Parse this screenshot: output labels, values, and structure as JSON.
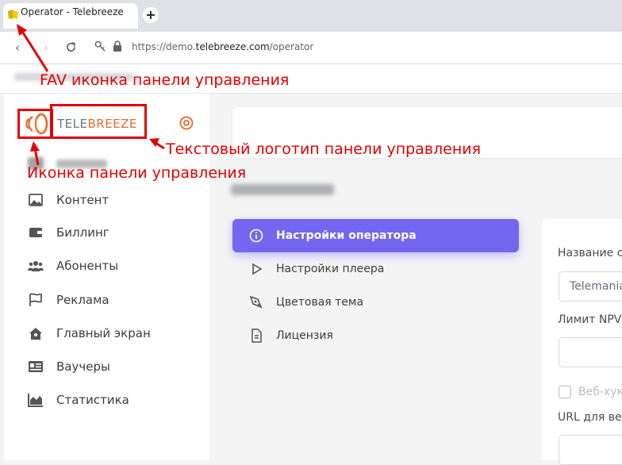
{
  "browser": {
    "tab_title": "Operator - Telebreeze",
    "new_tab": "+",
    "url_prefix": "https://demo.",
    "url_domain": "telebreeze.com",
    "url_path": "/operator"
  },
  "sidebar": {
    "logo": {
      "text_left": "TELE",
      "text_right": "BREEZE"
    },
    "items": [
      {
        "label": "Контент",
        "icon": "image-icon"
      },
      {
        "label": "Биллинг",
        "icon": "wallet-icon"
      },
      {
        "label": "Абоненты",
        "icon": "users-icon"
      },
      {
        "label": "Реклама",
        "icon": "flag-icon"
      },
      {
        "label": "Главный экран",
        "icon": "home-icon"
      },
      {
        "label": "Ваучеры",
        "icon": "id-card-icon"
      },
      {
        "label": "Статистика",
        "icon": "area-chart-icon"
      }
    ]
  },
  "settings_nav": [
    {
      "label": "Настройки оператора",
      "icon": "info-icon",
      "active": true
    },
    {
      "label": "Настройки плеера",
      "icon": "play-icon",
      "active": false
    },
    {
      "label": "Цветовая тема",
      "icon": "pen-tool-icon",
      "active": false
    },
    {
      "label": "Лицензия",
      "icon": "file-text-icon",
      "active": false
    }
  ],
  "form": {
    "name_label": "Название с",
    "name_value": "Telemania",
    "npvr_label": "Лимит NPV",
    "npvr_value": "",
    "webhook_label": "Веб-хук",
    "url_label": "URL для ве"
  },
  "annotations": {
    "fav": "FAV иконка панели управления",
    "text_logo": "Текстовый логотип панели управления",
    "icon": "Иконка панели управления"
  },
  "colors": {
    "accent": "#7367f0",
    "brand_orange": "#e46a2b",
    "annotation_red": "#e30000"
  }
}
